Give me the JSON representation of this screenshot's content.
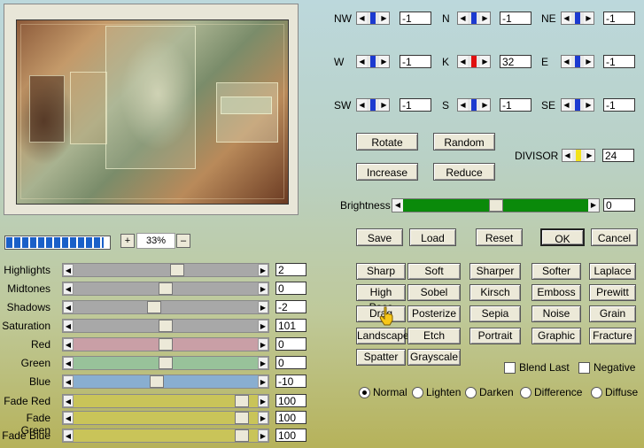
{
  "progress": {
    "fraction": 0.95
  },
  "zoom": {
    "plus": "+",
    "value": "33%",
    "minus": "–"
  },
  "adjustments": [
    {
      "label": "Highlights",
      "value": "2",
      "color": "#a8a8a8",
      "thumb": 0.57
    },
    {
      "label": "Midtones",
      "value": "0",
      "color": "#a8a8a8",
      "thumb": 0.5
    },
    {
      "label": "Shadows",
      "value": "-2",
      "color": "#a8a8a8",
      "thumb": 0.43
    },
    {
      "label": "Saturation",
      "value": "101",
      "color": "#a8a8a8",
      "thumb": 0.5
    },
    {
      "label": "Red",
      "value": "0",
      "color": "#c99fa6",
      "thumb": 0.5
    },
    {
      "label": "Green",
      "value": "0",
      "color": "#98c29a",
      "thumb": 0.5
    },
    {
      "label": "Blue",
      "value": "-10",
      "color": "#89aed0",
      "thumb": 0.45
    },
    {
      "label": "Fade Red",
      "value": "100",
      "color": "#c9c459",
      "thumb": 0.95
    },
    {
      "label": "Fade Green",
      "value": "100",
      "color": "#c9c459",
      "thumb": 0.95
    },
    {
      "label": "Fade Blue",
      "value": "100",
      "color": "#c9c459",
      "thumb": 0.95
    }
  ],
  "matrix": [
    {
      "label": "NW",
      "value": "-1"
    },
    {
      "label": "N",
      "value": "-1"
    },
    {
      "label": "NE",
      "value": "-1"
    },
    {
      "label": "W",
      "value": "-1"
    },
    {
      "label": "K",
      "value": "32"
    },
    {
      "label": "E",
      "value": "-1"
    },
    {
      "label": "SW",
      "value": "-1"
    },
    {
      "label": "S",
      "value": "-1"
    },
    {
      "label": "SE",
      "value": "-1"
    }
  ],
  "divisor": {
    "label": "DIVISOR",
    "value": "24"
  },
  "brightness": {
    "label": "Brightness",
    "value": "0",
    "thumb": 0.5
  },
  "buttons": {
    "rotate": "Rotate",
    "random": "Random",
    "increase": "Increase",
    "reduce": "Reduce",
    "save": "Save",
    "load": "Load",
    "reset": "Reset",
    "ok": "OK",
    "cancel": "Cancel"
  },
  "presets": [
    [
      "Sharp",
      "Soft",
      "Sharper",
      "Softer",
      "Laplace"
    ],
    [
      "High Pass",
      "Sobel",
      "Kirsch",
      "Emboss",
      "Prewitt"
    ],
    [
      "Drag",
      "Posterize",
      "Sepia",
      "Noise",
      "Grain"
    ],
    [
      "Landscape",
      "Etch",
      "Portrait",
      "Graphic",
      "Fracture"
    ],
    [
      "Spatter",
      "Grayscale"
    ]
  ],
  "options": {
    "blend_last": "Blend Last",
    "negative": "Negative"
  },
  "modes": [
    "Normal",
    "Lighten",
    "Darken",
    "Difference",
    "Diffuse"
  ],
  "selected_mode": "Normal",
  "colors": {
    "accent_blue": "#1c3ad0",
    "accent_red": "#e01010",
    "accent_yellow": "#f2e21a",
    "brightness_green": "#0a8a0a"
  },
  "icons": [
    "hand-cursor-icon"
  ]
}
